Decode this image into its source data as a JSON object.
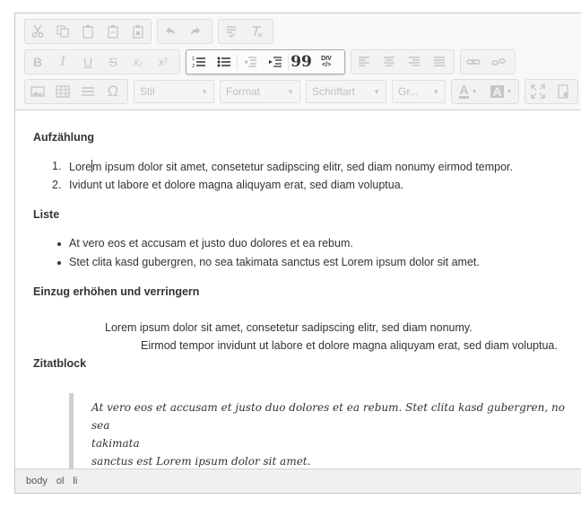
{
  "toolbar": {
    "row1": [
      {
        "icon": "cut-icon"
      },
      {
        "icon": "copy-icon"
      },
      {
        "icon": "paste-icon"
      },
      {
        "icon": "paste-text-icon"
      },
      {
        "icon": "paste-word-icon"
      },
      {
        "icon": "undo-icon"
      },
      {
        "icon": "redo-icon"
      },
      {
        "icon": "spellcheck-icon"
      },
      {
        "icon": "remove-format-icon"
      }
    ],
    "basic_styles": [
      "B",
      "I",
      "U",
      "S",
      "x₂",
      "x²"
    ],
    "blockquote_label": "99",
    "div_label": "DIV",
    "special_char_label": "Ω",
    "combos": {
      "style": "Stil",
      "format": "Format",
      "font": "Schriftart",
      "size": "Gr..."
    },
    "text_color_label": "A",
    "bg_color_label": "A"
  },
  "content": {
    "heading_enum": "Aufzählung",
    "ordered_items": [
      {
        "num": "1.",
        "text_a": "Lore",
        "text_b": "m ipsum dolor sit amet, consetetur sadipscing elitr, sed diam nonumy eirmod tempor."
      },
      {
        "num": "2.",
        "text": "Ividunt ut labore et dolore magna aliquyam erat, sed diam voluptua."
      }
    ],
    "heading_list": "Liste",
    "unordered_items": [
      "At vero eos et accusam et justo duo dolores et ea rebum.",
      "Stet clita kasd gubergren, no sea takimata sanctus est Lorem ipsum dolor sit amet."
    ],
    "heading_indent": "Einzug erhöhen und verringern",
    "indent_line_1": "Lorem ipsum dolor sit amet, consetetur sadipscing elitr, sed diam nonumy.",
    "indent_line_2": "Eirmod tempor invidunt ut labore et dolore magna aliquyam erat, sed diam voluptua.",
    "heading_quote": "Zitatblock",
    "quote_line_1": "At vero eos et accusam et justo duo dolores et ea rebum. Stet clita kasd gubergren, no sea",
    "quote_line_2": "takimata",
    "quote_line_3": "sanctus est Lorem ipsum dolor sit amet."
  },
  "statusbar": {
    "path": [
      "body",
      "ol",
      "li"
    ]
  }
}
